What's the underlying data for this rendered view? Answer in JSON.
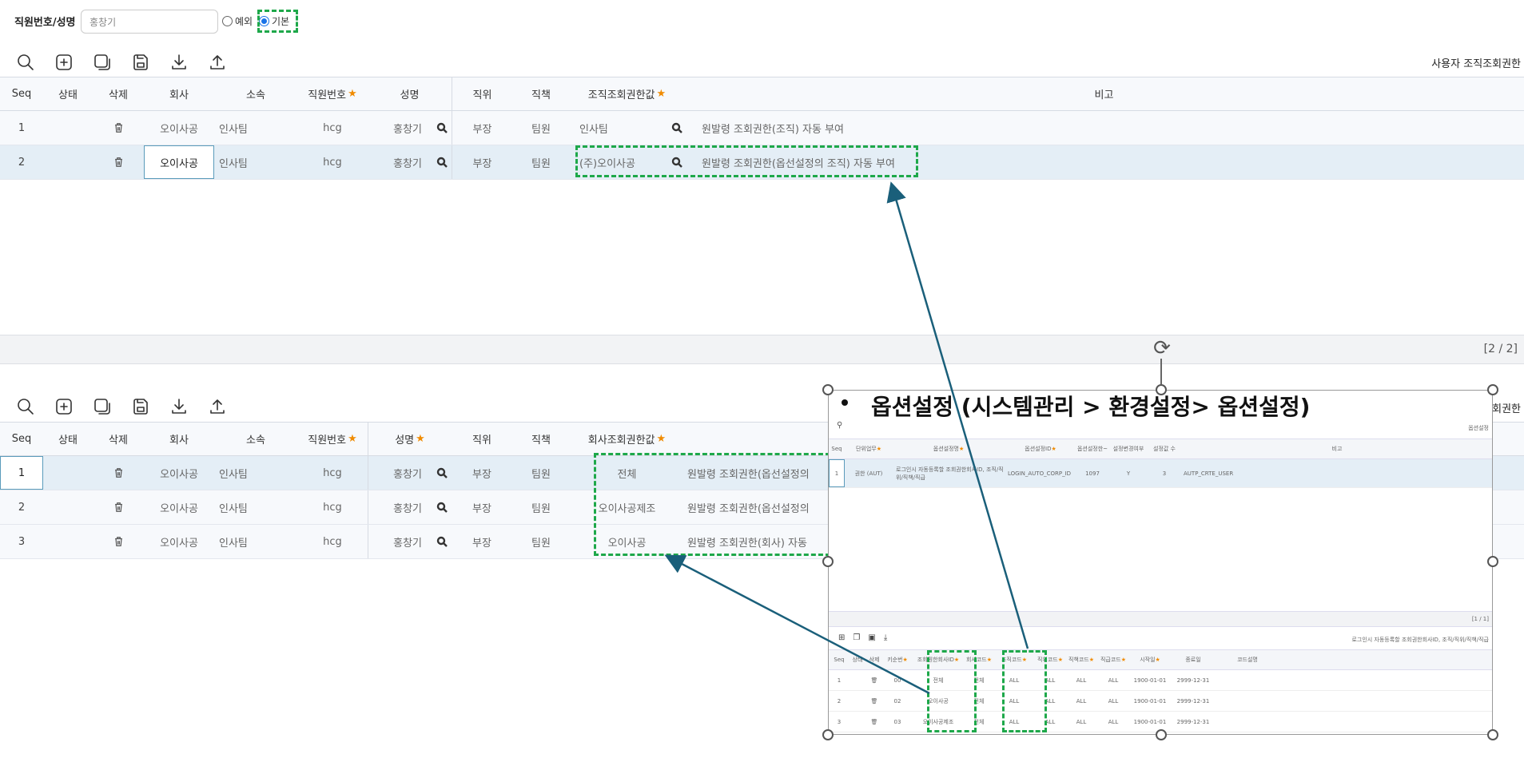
{
  "search": {
    "label": "직원번호/성명",
    "value": "홍창기",
    "radio_exception": "예외",
    "radio_default": "기본"
  },
  "top_panel": {
    "title": "사용자 조직조회권한",
    "headers": [
      "Seq",
      "상태",
      "삭제",
      "회사",
      "소속",
      "직원번호",
      "성명",
      "직위",
      "직책",
      "조직조회권한값",
      "비고"
    ],
    "rows": [
      {
        "seq": "1",
        "company": "오이사공",
        "dept": "인사팀",
        "emp_no": "hcg",
        "name": "홍창기",
        "position": "부장",
        "duty": "팀원",
        "value": "인사팀",
        "note": "원발령 조회권한(조직) 자동 부여"
      },
      {
        "seq": "2",
        "company": "오이사공",
        "dept": "인사팀",
        "emp_no": "hcg",
        "name": "홍창기",
        "position": "부장",
        "duty": "팀원",
        "value": "(주)오이사공",
        "note": "원발령 조회권한(옵선설정의 조직) 자동 부여"
      }
    ],
    "pager": "[2 / 2]"
  },
  "bottom_panel": {
    "title": "회사조회권한",
    "headers": [
      "Seq",
      "상태",
      "삭제",
      "회사",
      "소속",
      "직원번호",
      "성명",
      "직위",
      "직책",
      "회사조회권한값"
    ],
    "rows": [
      {
        "seq": "1",
        "company": "오이사공",
        "dept": "인사팀",
        "emp_no": "hcg",
        "name": "홍창기",
        "position": "부장",
        "duty": "팀원",
        "value": "전체",
        "note": "원발령 조회권한(옵선설정의"
      },
      {
        "seq": "2",
        "company": "오이사공",
        "dept": "인사팀",
        "emp_no": "hcg",
        "name": "홍창기",
        "position": "부장",
        "duty": "팀원",
        "value": "오이사공제조",
        "note": "원발령 조회권한(옵선설정의"
      },
      {
        "seq": "3",
        "company": "오이사공",
        "dept": "인사팀",
        "emp_no": "hcg",
        "name": "홍창기",
        "position": "부장",
        "duty": "팀원",
        "value": "오이사공",
        "note": "원발령 조회권한(회사) 자동"
      }
    ]
  },
  "overlay": {
    "title": "옵션설정 (시스템관리 > 환경설정> 옵션설정)",
    "mini_top_headers": [
      "Seq",
      "단위업무",
      "옵션설정명",
      "옵션설정ID",
      "옵션설정한~",
      "설정변경여부",
      "설정값 수",
      "비고"
    ],
    "mini_top_row": [
      "1",
      "권한 (AUT)",
      "로그인시 자동등록할 조회권한회사ID, 조직/직위/직책/직급",
      "LOGIN_AUTO_CORP_ID",
      "1097",
      "Y",
      "3",
      "AUTP_CRTE_USER"
    ],
    "mini_right_label": "옵션설정",
    "mini_pager": "[1 / 1]",
    "mini_sub_title": "로그인시 자동등록할 조회권한회사ID, 조직/직위/직책/직급",
    "mini_bottom_headers": [
      "Seq",
      "상태",
      "삭제",
      "키순번",
      "조회권한회사ID",
      "회사코드",
      "조직코드",
      "직위코드",
      "직책코드",
      "직급코드",
      "시작일",
      "종료일",
      "코드설명"
    ],
    "mini_bottom_rows": [
      [
        "1",
        "00",
        "전체",
        "전체",
        "ALL",
        "ALL",
        "ALL",
        "ALL",
        "1900-01-01",
        "2999-12-31"
      ],
      [
        "2",
        "02",
        "오이사공",
        "전체",
        "ALL",
        "ALL",
        "ALL",
        "ALL",
        "1900-01-01",
        "2999-12-31"
      ],
      [
        "3",
        "03",
        "오이사공제조",
        "전체",
        "ALL",
        "ALL",
        "ALL",
        "ALL",
        "1900-01-01",
        "2999-12-31"
      ]
    ]
  },
  "colors": {
    "highlight_dash": "#1ea84a",
    "arrow": "#1a5f7a",
    "selected_row": "#e4eef6",
    "required_star": "#f08b00"
  }
}
